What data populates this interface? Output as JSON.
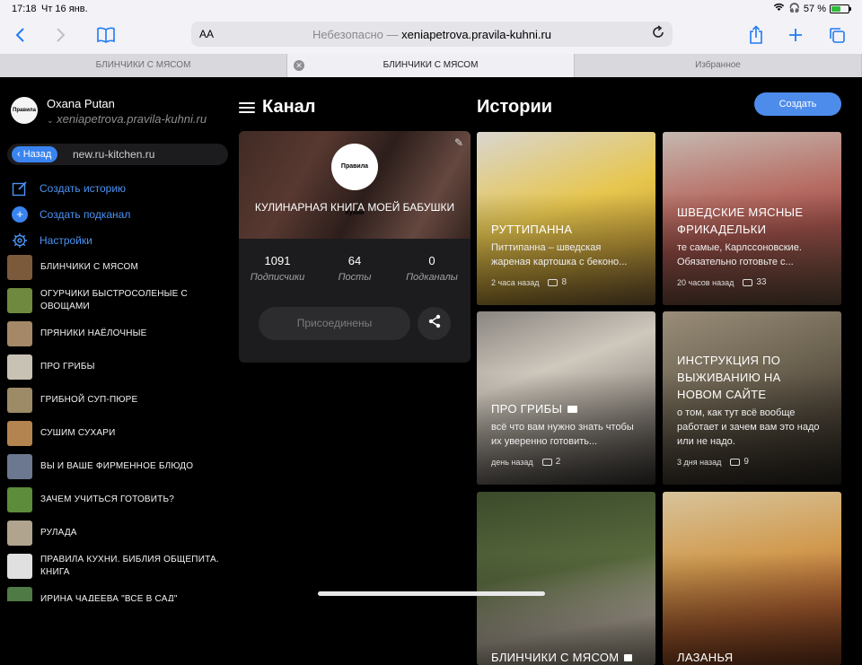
{
  "status": {
    "time": "17:18",
    "date": "Чт 16 янв.",
    "battery": "57 %",
    "battery_level": 0.57
  },
  "browser": {
    "aa": "AA",
    "url_prefix": "Небезопасно — ",
    "url_host": "xeniapetrova.pravila-kuhni.ru",
    "tabs": [
      {
        "label": "БЛИНЧИКИ С МЯСОМ"
      },
      {
        "label": "БЛИНЧИКИ С МЯСОМ"
      },
      {
        "label": "Избранное"
      }
    ]
  },
  "profile": {
    "name": "Oxana Putan",
    "site": "xeniapetrova.pravila-kuhni.ru",
    "logo_text": "Правила Кухни"
  },
  "nav": {
    "back_label": "Назад",
    "back_url": "new.ru-kitchen.ru"
  },
  "actions": [
    {
      "label": "Создать историю",
      "icon": "compose-icon"
    },
    {
      "label": "Создать подканал",
      "icon": "plus-circle-icon"
    },
    {
      "label": "Настройки",
      "icon": "gear-icon"
    }
  ],
  "channels": [
    {
      "name": "БЛИНЧИКИ С МЯСОМ",
      "color": "#7b5a3c"
    },
    {
      "name": "ОГУРЧИКИ БЫСТРОСОЛЕНЫЕ  С ОВОЩАМИ",
      "color": "#6f8a3e"
    },
    {
      "name": "ПРЯНИКИ наёлочные",
      "color": "#a48867"
    },
    {
      "name": "ПРО ГРИБЫ",
      "color": "#c8c2b5"
    },
    {
      "name": "ГРИБНОЙ СУП-ПЮРЕ",
      "color": "#9d8a66"
    },
    {
      "name": "СУШИМ СУХАРИ",
      "color": "#b3844f"
    },
    {
      "name": "ВЫ И ВАШЕ ФИРМЕННОЕ БЛЮДО",
      "color": "#6c7890"
    },
    {
      "name": "ЗАЧЕМ УЧИТЬСЯ ГОТОВИТЬ?",
      "color": "#5d8c3a"
    },
    {
      "name": "РУЛАДА",
      "color": "#b0a48f"
    },
    {
      "name": "ПРАВИЛА КУХНИ. БИБЛИЯ ОБЩЕПИТА. КНИГА",
      "color": "#e0e0e0"
    },
    {
      "name": "ИРИНА ЧАДЕЕВА \"ВСЕ В САД\"",
      "color": "#4f7a45"
    }
  ],
  "channel_card": {
    "header": "Канал",
    "name": "КУЛИНАРНАЯ КНИГА МОЕЙ БАБУШКИ",
    "logo_text": "Правила Кухни",
    "stats": [
      {
        "num": "1091",
        "label": "Подписчики"
      },
      {
        "num": "64",
        "label": "Посты"
      },
      {
        "num": "0",
        "label": "Подканалы"
      }
    ],
    "join_label": "Присоединены"
  },
  "stories": {
    "title": "Истории",
    "create_label": "Создать",
    "items": [
      {
        "title": "РУТТИПАННА",
        "desc": "Питтипанна – шведская жареная картошка с беконо...",
        "time": "2 часа назад",
        "comments": "8",
        "bg": "linear-gradient(160deg,#d9d6d0 0%,#e7c64e 45%,#c9a33b 70%,#8a6a3a 100%)",
        "flag": ""
      },
      {
        "title": "ШВЕДСКИЕ МЯСНЫЕ ФРИКАДЕЛЬКИ",
        "desc": "те самые, Карлссоновские. Обязательно готовьте с...",
        "time": "20 часов назад",
        "comments": "33",
        "bg": "linear-gradient(170deg,#c5b8b0 0%,#b66b62 40%,#9c4f49 60%,#6b5540 100%)",
        "flag": ""
      },
      {
        "title": "ПРО ГРИБЫ",
        "desc": "всё что вам нужно знать чтобы их уверенно готовить...",
        "time": "день назад",
        "comments": "2",
        "bg": "linear-gradient(160deg,#8a8580 0%,#cfc8bd 35%,#9d968d 60%,#3a3632 100%)",
        "flag": "video"
      },
      {
        "title": "ИНСТРУКЦИЯ ПО ВЫЖИВАНИЮ НА НОВОМ САЙТЕ",
        "desc": "о том, как тут всё вообще работает и зачем вам это надо или не надо.",
        "time": "3 дня назад",
        "comments": "9",
        "bg": "linear-gradient(160deg,#9a8e7a 0%,#6e6452 40%,#4a4236 70%,#2a2620 100%)",
        "flag": ""
      },
      {
        "title": "БЛИНЧИКИ С МЯСОМ",
        "desc": "",
        "time": "",
        "comments": "",
        "bg": "linear-gradient(170deg,#3b4a2a 0%,#58693d 45%,#c9bfae 75%,#a09786 100%)",
        "flag": "lock"
      },
      {
        "title": "ЛАЗАНЬЯ",
        "desc": "",
        "time": "",
        "comments": "",
        "bg": "linear-gradient(170deg,#d7c49b 0%,#d19a4f 40%,#b66432 70%,#7a3b1f 100%)",
        "flag": ""
      }
    ]
  }
}
